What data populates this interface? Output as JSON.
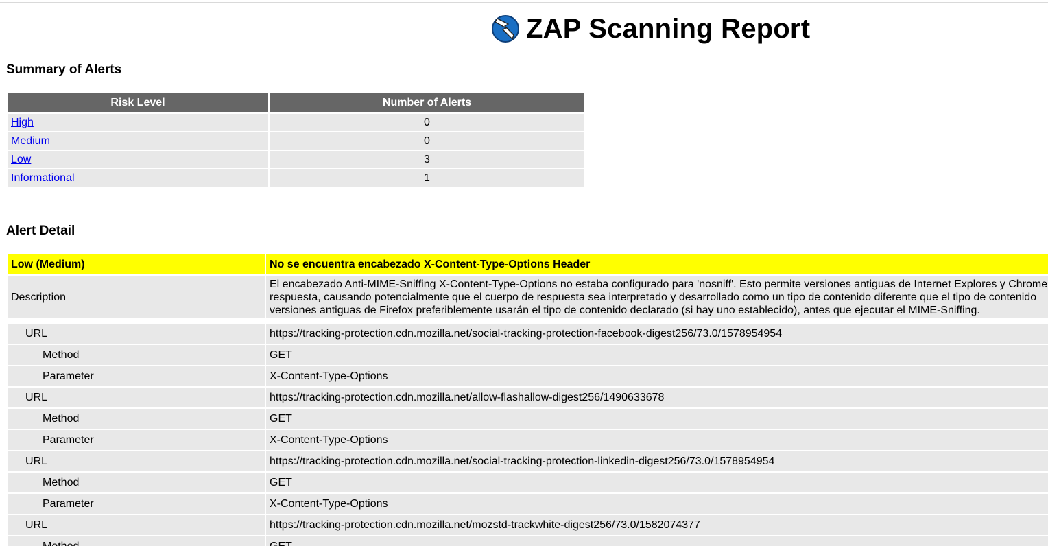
{
  "report": {
    "title": "ZAP Scanning Report",
    "logo_icon": "zap-lightning-icon"
  },
  "summary": {
    "heading": "Summary of Alerts",
    "col_risk": "Risk Level",
    "col_count": "Number of Alerts",
    "rows": [
      {
        "risk": "High",
        "count": "0"
      },
      {
        "risk": "Medium",
        "count": "0"
      },
      {
        "risk": "Low",
        "count": "3"
      },
      {
        "risk": "Informational",
        "count": "1"
      }
    ]
  },
  "detail": {
    "heading": "Alert Detail",
    "alert": {
      "level": "Low (Medium)",
      "name": "No se encuentra encabezado X-Content-Type-Options Header",
      "desc_label": "Description",
      "desc_lines": [
        "El encabezado Anti-MIME-Sniffing X-Content-Type-Options no estaba configurado para 'nosniff'. Esto permite versiones antiguas de Internet Explores y Chrome",
        "respuesta, causando potencialmente que el cuerpo de respuesta sea interpretado y desarrollado como un tipo de contenido diferente que el tipo de contenido",
        "versiones antiguas de Firefox preferiblemente usarán el tipo de contenido declarado (si hay uno establecido), antes que ejecutar el MIME-Sniffing."
      ],
      "instances": [
        {
          "url_label": "URL",
          "url": "https://tracking-protection.cdn.mozilla.net/social-tracking-protection-facebook-digest256/73.0/1578954954",
          "method_label": "Method",
          "method": "GET",
          "param_label": "Parameter",
          "param": "X-Content-Type-Options"
        },
        {
          "url_label": "URL",
          "url": "https://tracking-protection.cdn.mozilla.net/allow-flashallow-digest256/1490633678",
          "method_label": "Method",
          "method": "GET",
          "param_label": "Parameter",
          "param": "X-Content-Type-Options"
        },
        {
          "url_label": "URL",
          "url": "https://tracking-protection.cdn.mozilla.net/social-tracking-protection-linkedin-digest256/73.0/1578954954",
          "method_label": "Method",
          "method": "GET",
          "param_label": "Parameter",
          "param": "X-Content-Type-Options"
        },
        {
          "url_label": "URL",
          "url": "https://tracking-protection.cdn.mozilla.net/mozstd-trackwhite-digest256/73.0/1582074377",
          "method_label": "Method",
          "method": "GET"
        }
      ]
    }
  }
}
